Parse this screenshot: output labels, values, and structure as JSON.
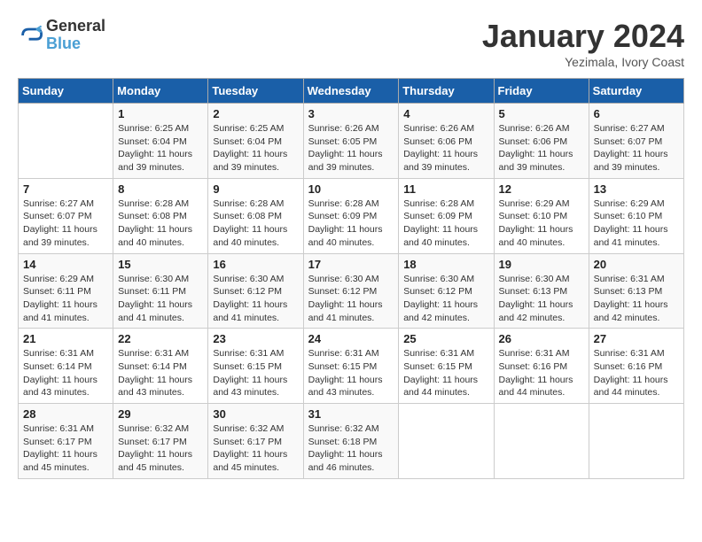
{
  "logo": {
    "line1": "General",
    "line2": "Blue"
  },
  "title": "January 2024",
  "subtitle": "Yezimala, Ivory Coast",
  "header": {
    "days": [
      "Sunday",
      "Monday",
      "Tuesday",
      "Wednesday",
      "Thursday",
      "Friday",
      "Saturday"
    ]
  },
  "weeks": [
    [
      {
        "day": "",
        "info": ""
      },
      {
        "day": "1",
        "info": "Sunrise: 6:25 AM\nSunset: 6:04 PM\nDaylight: 11 hours and 39 minutes."
      },
      {
        "day": "2",
        "info": "Sunrise: 6:25 AM\nSunset: 6:04 PM\nDaylight: 11 hours and 39 minutes."
      },
      {
        "day": "3",
        "info": "Sunrise: 6:26 AM\nSunset: 6:05 PM\nDaylight: 11 hours and 39 minutes."
      },
      {
        "day": "4",
        "info": "Sunrise: 6:26 AM\nSunset: 6:06 PM\nDaylight: 11 hours and 39 minutes."
      },
      {
        "day": "5",
        "info": "Sunrise: 6:26 AM\nSunset: 6:06 PM\nDaylight: 11 hours and 39 minutes."
      },
      {
        "day": "6",
        "info": "Sunrise: 6:27 AM\nSunset: 6:07 PM\nDaylight: 11 hours and 39 minutes."
      }
    ],
    [
      {
        "day": "7",
        "info": "Sunrise: 6:27 AM\nSunset: 6:07 PM\nDaylight: 11 hours and 39 minutes."
      },
      {
        "day": "8",
        "info": "Sunrise: 6:28 AM\nSunset: 6:08 PM\nDaylight: 11 hours and 40 minutes."
      },
      {
        "day": "9",
        "info": "Sunrise: 6:28 AM\nSunset: 6:08 PM\nDaylight: 11 hours and 40 minutes."
      },
      {
        "day": "10",
        "info": "Sunrise: 6:28 AM\nSunset: 6:09 PM\nDaylight: 11 hours and 40 minutes."
      },
      {
        "day": "11",
        "info": "Sunrise: 6:28 AM\nSunset: 6:09 PM\nDaylight: 11 hours and 40 minutes."
      },
      {
        "day": "12",
        "info": "Sunrise: 6:29 AM\nSunset: 6:10 PM\nDaylight: 11 hours and 40 minutes."
      },
      {
        "day": "13",
        "info": "Sunrise: 6:29 AM\nSunset: 6:10 PM\nDaylight: 11 hours and 41 minutes."
      }
    ],
    [
      {
        "day": "14",
        "info": "Sunrise: 6:29 AM\nSunset: 6:11 PM\nDaylight: 11 hours and 41 minutes."
      },
      {
        "day": "15",
        "info": "Sunrise: 6:30 AM\nSunset: 6:11 PM\nDaylight: 11 hours and 41 minutes."
      },
      {
        "day": "16",
        "info": "Sunrise: 6:30 AM\nSunset: 6:12 PM\nDaylight: 11 hours and 41 minutes."
      },
      {
        "day": "17",
        "info": "Sunrise: 6:30 AM\nSunset: 6:12 PM\nDaylight: 11 hours and 41 minutes."
      },
      {
        "day": "18",
        "info": "Sunrise: 6:30 AM\nSunset: 6:12 PM\nDaylight: 11 hours and 42 minutes."
      },
      {
        "day": "19",
        "info": "Sunrise: 6:30 AM\nSunset: 6:13 PM\nDaylight: 11 hours and 42 minutes."
      },
      {
        "day": "20",
        "info": "Sunrise: 6:31 AM\nSunset: 6:13 PM\nDaylight: 11 hours and 42 minutes."
      }
    ],
    [
      {
        "day": "21",
        "info": "Sunrise: 6:31 AM\nSunset: 6:14 PM\nDaylight: 11 hours and 43 minutes."
      },
      {
        "day": "22",
        "info": "Sunrise: 6:31 AM\nSunset: 6:14 PM\nDaylight: 11 hours and 43 minutes."
      },
      {
        "day": "23",
        "info": "Sunrise: 6:31 AM\nSunset: 6:15 PM\nDaylight: 11 hours and 43 minutes."
      },
      {
        "day": "24",
        "info": "Sunrise: 6:31 AM\nSunset: 6:15 PM\nDaylight: 11 hours and 43 minutes."
      },
      {
        "day": "25",
        "info": "Sunrise: 6:31 AM\nSunset: 6:15 PM\nDaylight: 11 hours and 44 minutes."
      },
      {
        "day": "26",
        "info": "Sunrise: 6:31 AM\nSunset: 6:16 PM\nDaylight: 11 hours and 44 minutes."
      },
      {
        "day": "27",
        "info": "Sunrise: 6:31 AM\nSunset: 6:16 PM\nDaylight: 11 hours and 44 minutes."
      }
    ],
    [
      {
        "day": "28",
        "info": "Sunrise: 6:31 AM\nSunset: 6:17 PM\nDaylight: 11 hours and 45 minutes."
      },
      {
        "day": "29",
        "info": "Sunrise: 6:32 AM\nSunset: 6:17 PM\nDaylight: 11 hours and 45 minutes."
      },
      {
        "day": "30",
        "info": "Sunrise: 6:32 AM\nSunset: 6:17 PM\nDaylight: 11 hours and 45 minutes."
      },
      {
        "day": "31",
        "info": "Sunrise: 6:32 AM\nSunset: 6:18 PM\nDaylight: 11 hours and 46 minutes."
      },
      {
        "day": "",
        "info": ""
      },
      {
        "day": "",
        "info": ""
      },
      {
        "day": "",
        "info": ""
      }
    ]
  ]
}
